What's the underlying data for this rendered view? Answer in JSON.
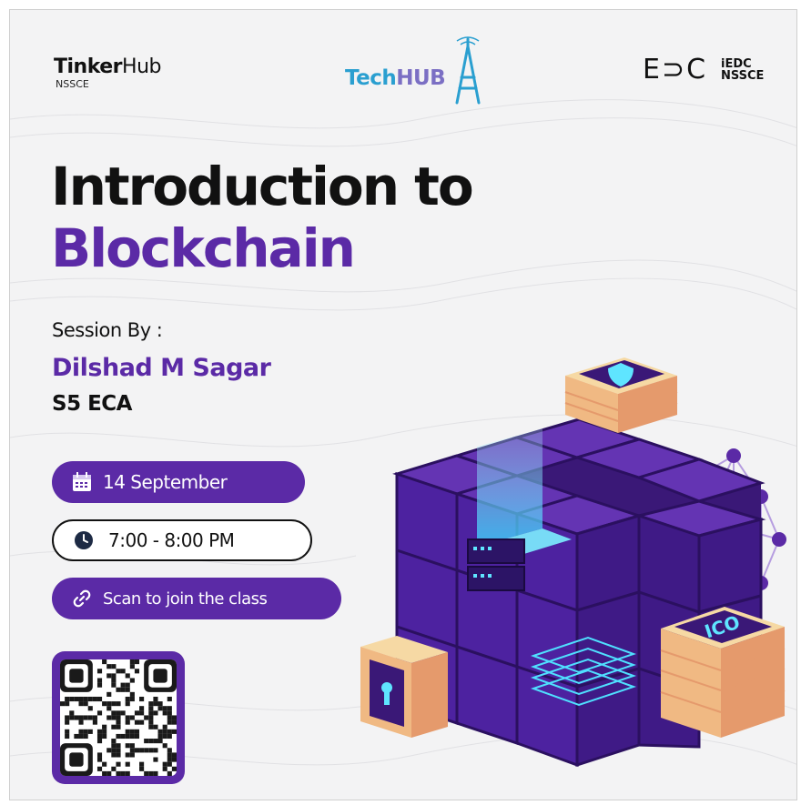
{
  "logos": {
    "tinkerhub_main": "Tinker",
    "tinkerhub_hub": "Hub",
    "tinkerhub_sub": "NSSCE",
    "techhub_tech": "Tech",
    "techhub_hub": "HUB",
    "edc_mark": "E⊃C",
    "edc_line1": "iEDC",
    "edc_line2": "NSSCE"
  },
  "title": {
    "line1": "Introduction to",
    "line2": "Blockchain"
  },
  "session": {
    "label": "Session By :",
    "speaker": "Dilshad M Sagar",
    "dept": "S5 ECA"
  },
  "event": {
    "date": "14 September",
    "time": "7:00 - 8:00 PM",
    "scan": "Scan to join the class"
  },
  "icons": [
    "calendar-icon",
    "clock-icon",
    "link-icon",
    "shield-icon",
    "keyhole-icon",
    "qr-code"
  ],
  "illustration_text": {
    "ico": "ICO"
  },
  "colors": {
    "accent": "#5b2aa6",
    "dark_text": "#111111",
    "techhub_blue": "#2a9fd0",
    "cube_purple": "#4a1f8c",
    "gold": "#f3cf8f"
  }
}
